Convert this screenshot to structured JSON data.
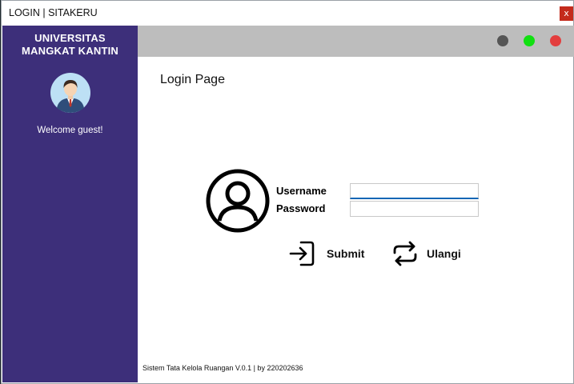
{
  "window": {
    "title": "LOGIN | SITAKERU",
    "close_label": "x"
  },
  "sidebar": {
    "university_line1": "UNIVERSITAS",
    "university_line2": "MANGKAT KANTIN",
    "welcome": "Welcome guest!",
    "color": "#3d2f7a"
  },
  "topbar": {
    "buttons": [
      {
        "name": "minimize",
        "color": "#555555"
      },
      {
        "name": "maximize",
        "color": "#11e011"
      },
      {
        "name": "close",
        "color": "#e33e3e"
      }
    ]
  },
  "main": {
    "page_title": "Login Page",
    "username_label": "Username",
    "password_label": "Password",
    "username_value": "",
    "password_value": "",
    "submit_label": "Submit",
    "reset_label": "Ulangi",
    "icons": {
      "user": "user-circle-icon",
      "submit": "sign-in-icon",
      "reset": "repeat-icon"
    }
  },
  "footer": {
    "text": "Sistem Tata Kelola Ruangan V.0.1 | by 220202636"
  }
}
